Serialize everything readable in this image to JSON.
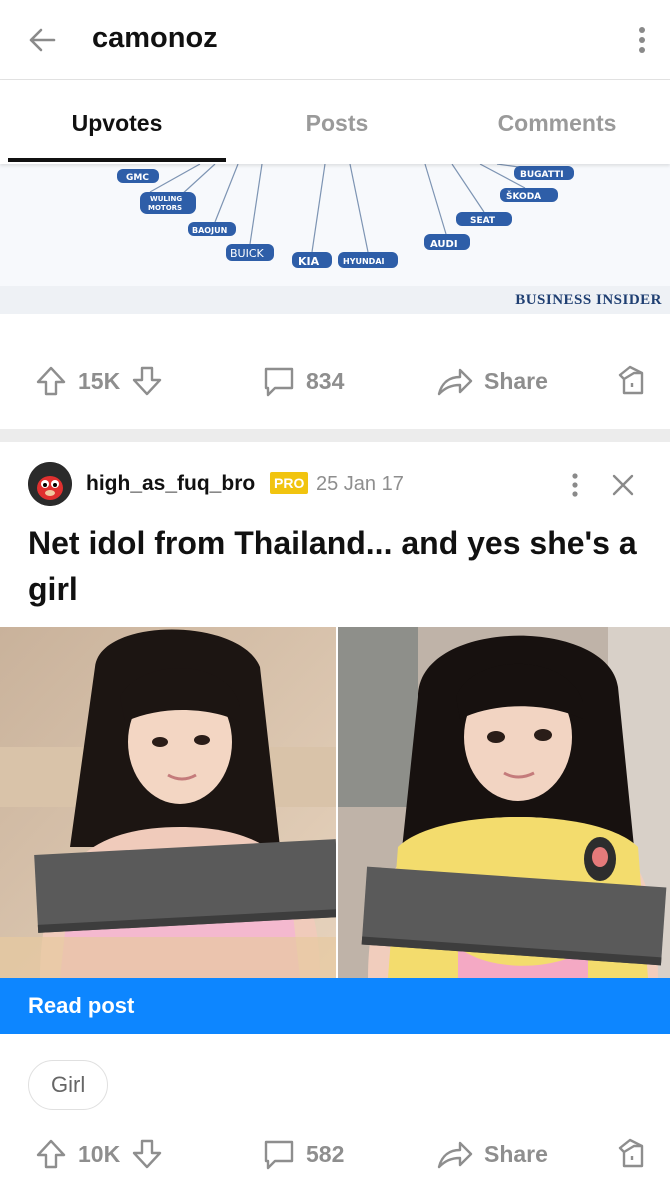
{
  "appbar": {
    "title": "camonoz",
    "back_icon": "arrow-left-icon",
    "more_icon": "more-vert-icon"
  },
  "tabs": [
    {
      "label": "Upvotes",
      "active": true
    },
    {
      "label": "Posts",
      "active": false
    },
    {
      "label": "Comments",
      "active": false
    }
  ],
  "card1": {
    "image_alt_brands": [
      "GMC",
      "WULING MOTORS",
      "BAOJUN",
      "BUICK",
      "KIA",
      "HYUNDAI",
      "AUDI",
      "SEAT",
      "ŠKODA",
      "BUGATTI"
    ],
    "watermark": "BUSINESS INSIDER",
    "actions": {
      "upvotes": "15K",
      "comments": "834",
      "share": "Share"
    }
  },
  "card2": {
    "author": "high_as_fuq_bro",
    "badge": "PRO",
    "date": "25 Jan 17",
    "title": "Net idol from Thailand... and yes she's a girl",
    "read_post": "Read post",
    "tag": "Girl",
    "actions": {
      "upvotes": "10K",
      "comments": "582",
      "share": "Share"
    }
  },
  "colors": {
    "accent": "#0d86ff",
    "pro_badge": "#f1c40f",
    "muted": "#8e8e8e"
  }
}
